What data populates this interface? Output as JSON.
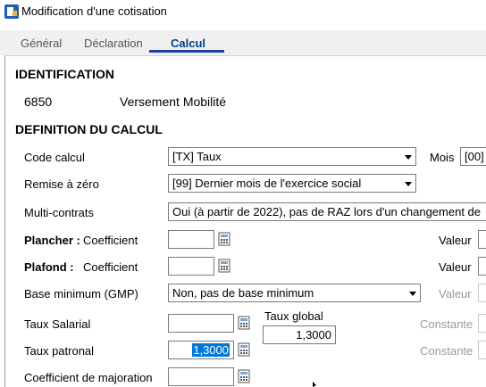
{
  "window": {
    "title": "Modification d'une cotisation"
  },
  "tabs": [
    {
      "label": "Général",
      "active": false
    },
    {
      "label": "Déclaration",
      "active": false
    },
    {
      "label": "Calcul",
      "active": true
    }
  ],
  "identification": {
    "heading": "IDENTIFICATION",
    "code": "6850",
    "name": "Versement Mobilité"
  },
  "definition": {
    "heading": "DEFINITION DU CALCUL",
    "code_calcul": {
      "label": "Code calcul",
      "value": "[TX]  Taux"
    },
    "mois": {
      "label": "Mois",
      "value": "[00]"
    },
    "remise_zero": {
      "label": "Remise à zéro",
      "value": "[99] Dernier mois de l'exercice social"
    },
    "multi_contrats": {
      "label": "Multi-contrats",
      "value": "Oui (à partir de 2022), pas de RAZ lors d'un changement de"
    },
    "plancher": {
      "label": "Plancher :",
      "coef_label": "Coefficient",
      "coef_value": "",
      "valeur_label": "Valeur"
    },
    "plafond": {
      "label": "Plafond :",
      "coef_label": "Coefficient",
      "coef_value": "",
      "valeur_label": "Valeur"
    },
    "base_minimum": {
      "label": "Base minimum (GMP)",
      "value": "Non, pas de base minimum",
      "valeur_label": "Valeur"
    },
    "taux_salarial": {
      "label": "Taux Salarial",
      "value": "",
      "constante_label": "Constante"
    },
    "taux_global": {
      "label": "Taux global",
      "value": "1,3000"
    },
    "taux_patronal": {
      "label": "Taux patronal",
      "value": "1,3000",
      "constante_label": "Constante"
    },
    "coef_majoration": {
      "label": "Coefficient de majoration",
      "value": ""
    }
  },
  "colors": {
    "accent": "#1d3f9c",
    "selection": "#0078d7",
    "disabled_text": "#9a9a9a"
  }
}
